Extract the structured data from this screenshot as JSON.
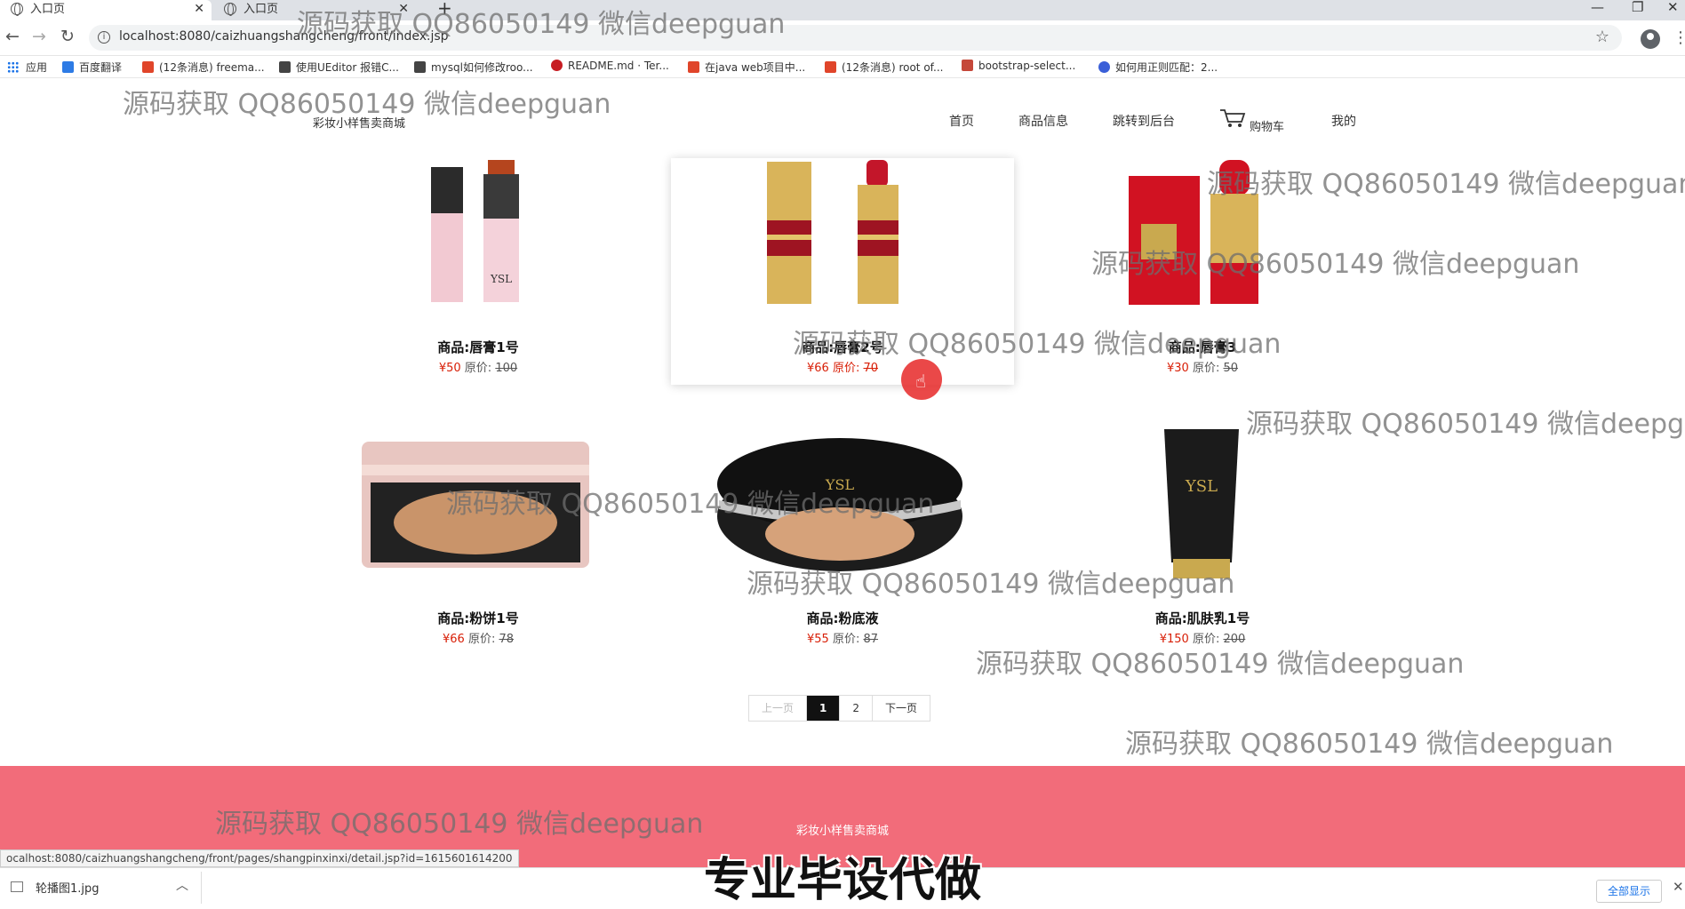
{
  "browser": {
    "tabs": [
      {
        "title": "入口页",
        "active": true
      },
      {
        "title": "入口页",
        "active": false
      }
    ],
    "url": "localhost:8080/caizhuangshangcheng/front/index.jsp",
    "bookmarks": [
      {
        "label": "应用",
        "icon": "apps-icon"
      },
      {
        "label": "百度翻译",
        "icon": "baidu-translate-icon",
        "color": "#2d7be5"
      },
      {
        "label": "(12条消息) freema...",
        "icon": "csdn-icon",
        "color": "#e0452a"
      },
      {
        "label": "使用UEditor 报错C...",
        "icon": "bird-icon",
        "color": "#444444"
      },
      {
        "label": "mysql如何修改roo...",
        "icon": "bird-icon",
        "color": "#444444"
      },
      {
        "label": "README.md · Ter...",
        "icon": "gitee-icon",
        "color": "#c71d23"
      },
      {
        "label": "在java web项目中...",
        "icon": "csdn-icon",
        "color": "#e0452a"
      },
      {
        "label": "(12条消息) root of...",
        "icon": "csdn-icon",
        "color": "#e0452a"
      },
      {
        "label": "bootstrap-select...",
        "icon": "cnblogs-icon",
        "color": "#c5483a"
      },
      {
        "label": "如何用正则匹配：2...",
        "icon": "baidu-paw-icon",
        "color": "#3a5fd8"
      }
    ],
    "status_url": "ocalhost:8080/caizhuangshangcheng/front/pages/shangpinxinxi/detail.jsp?id=1615601614200",
    "download": {
      "filename": "轮播图1.jpg",
      "show_all": "全部显示"
    }
  },
  "site": {
    "title": "彩妆小样售卖商城",
    "nav": [
      "首页",
      "商品信息",
      "跳转到后台",
      "购物车",
      "我的"
    ],
    "footer_title": "彩妆小样售卖商城"
  },
  "products": [
    {
      "name": "商品:唇膏1号",
      "price": "¥50",
      "orig_label": "原价:",
      "orig_price": "100",
      "image": "lipstick-1-image"
    },
    {
      "name": "商品:唇膏2号",
      "price": "¥66",
      "orig_label": "原价:",
      "orig_price": "70",
      "image": "lipstick-2-image"
    },
    {
      "name": "商品:唇膏3",
      "price": "¥30",
      "orig_label": "原价:",
      "orig_price": "50",
      "image": "lipstick-3-image"
    },
    {
      "name": "商品:粉饼1号",
      "price": "¥66",
      "orig_label": "原价:",
      "orig_price": "78",
      "image": "powder-compact-image"
    },
    {
      "name": "商品:粉底液",
      "price": "¥55",
      "orig_label": "原价:",
      "orig_price": "87",
      "image": "cushion-foundation-image"
    },
    {
      "name": "商品:肌肤乳1号",
      "price": "¥150",
      "orig_label": "原价:",
      "orig_price": "200",
      "image": "skin-lotion-image"
    }
  ],
  "pagination": {
    "prev": "上一页",
    "pages": [
      "1",
      "2"
    ],
    "current": "1",
    "next": "下一页"
  },
  "watermark": "源码获取 QQ86050149 微信deepguan",
  "promo": "专业毕设代做",
  "colors": {
    "footer": "#f26c7a",
    "price": "#d81e06",
    "pager_active": "#111111"
  }
}
